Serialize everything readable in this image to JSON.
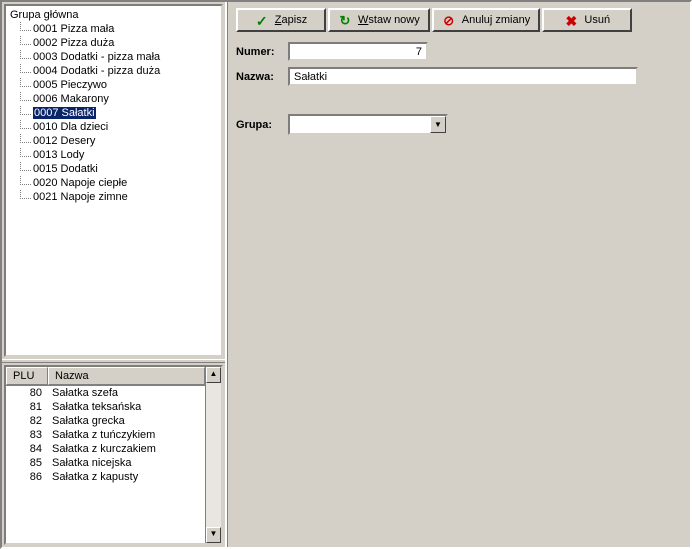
{
  "tree": {
    "root": "Grupa główna",
    "items": [
      "0001 Pizza mała",
      "0002 Pizza duża",
      "0003 Dodatki - pizza mała",
      "0004 Dodatki - pizza duża",
      "0005 Pieczywo",
      "0006 Makarony",
      "0007 Sałatki",
      "0010 Dla dzieci",
      "0012 Desery",
      "0013 Lody",
      "0015 Dodatki",
      "0020 Napoje ciepłe",
      "0021 Napoje zimne"
    ],
    "selected_index": 6
  },
  "table": {
    "headers": {
      "plu": "PLU",
      "nazwa": "Nazwa"
    },
    "rows": [
      {
        "plu": "80",
        "nazwa": "Sałatka szefa"
      },
      {
        "plu": "81",
        "nazwa": "Sałatka teksańska"
      },
      {
        "plu": "82",
        "nazwa": "Sałatka grecka"
      },
      {
        "plu": "83",
        "nazwa": "Sałatka z tuńczykiem"
      },
      {
        "plu": "84",
        "nazwa": "Sałatka z kurczakiem"
      },
      {
        "plu": "85",
        "nazwa": "Sałatka nicejska"
      },
      {
        "plu": "86",
        "nazwa": "Sałatka z kapusty"
      }
    ]
  },
  "toolbar": {
    "save": "Zapisz",
    "insert": "Wstaw nowy",
    "cancel": "Anuluj zmiany",
    "delete": "Usuń"
  },
  "form": {
    "numer_label": "Numer:",
    "numer_value": "7",
    "nazwa_label": "Nazwa:",
    "nazwa_value": "Sałatki",
    "grupa_label": "Grupa:",
    "grupa_value": ""
  }
}
